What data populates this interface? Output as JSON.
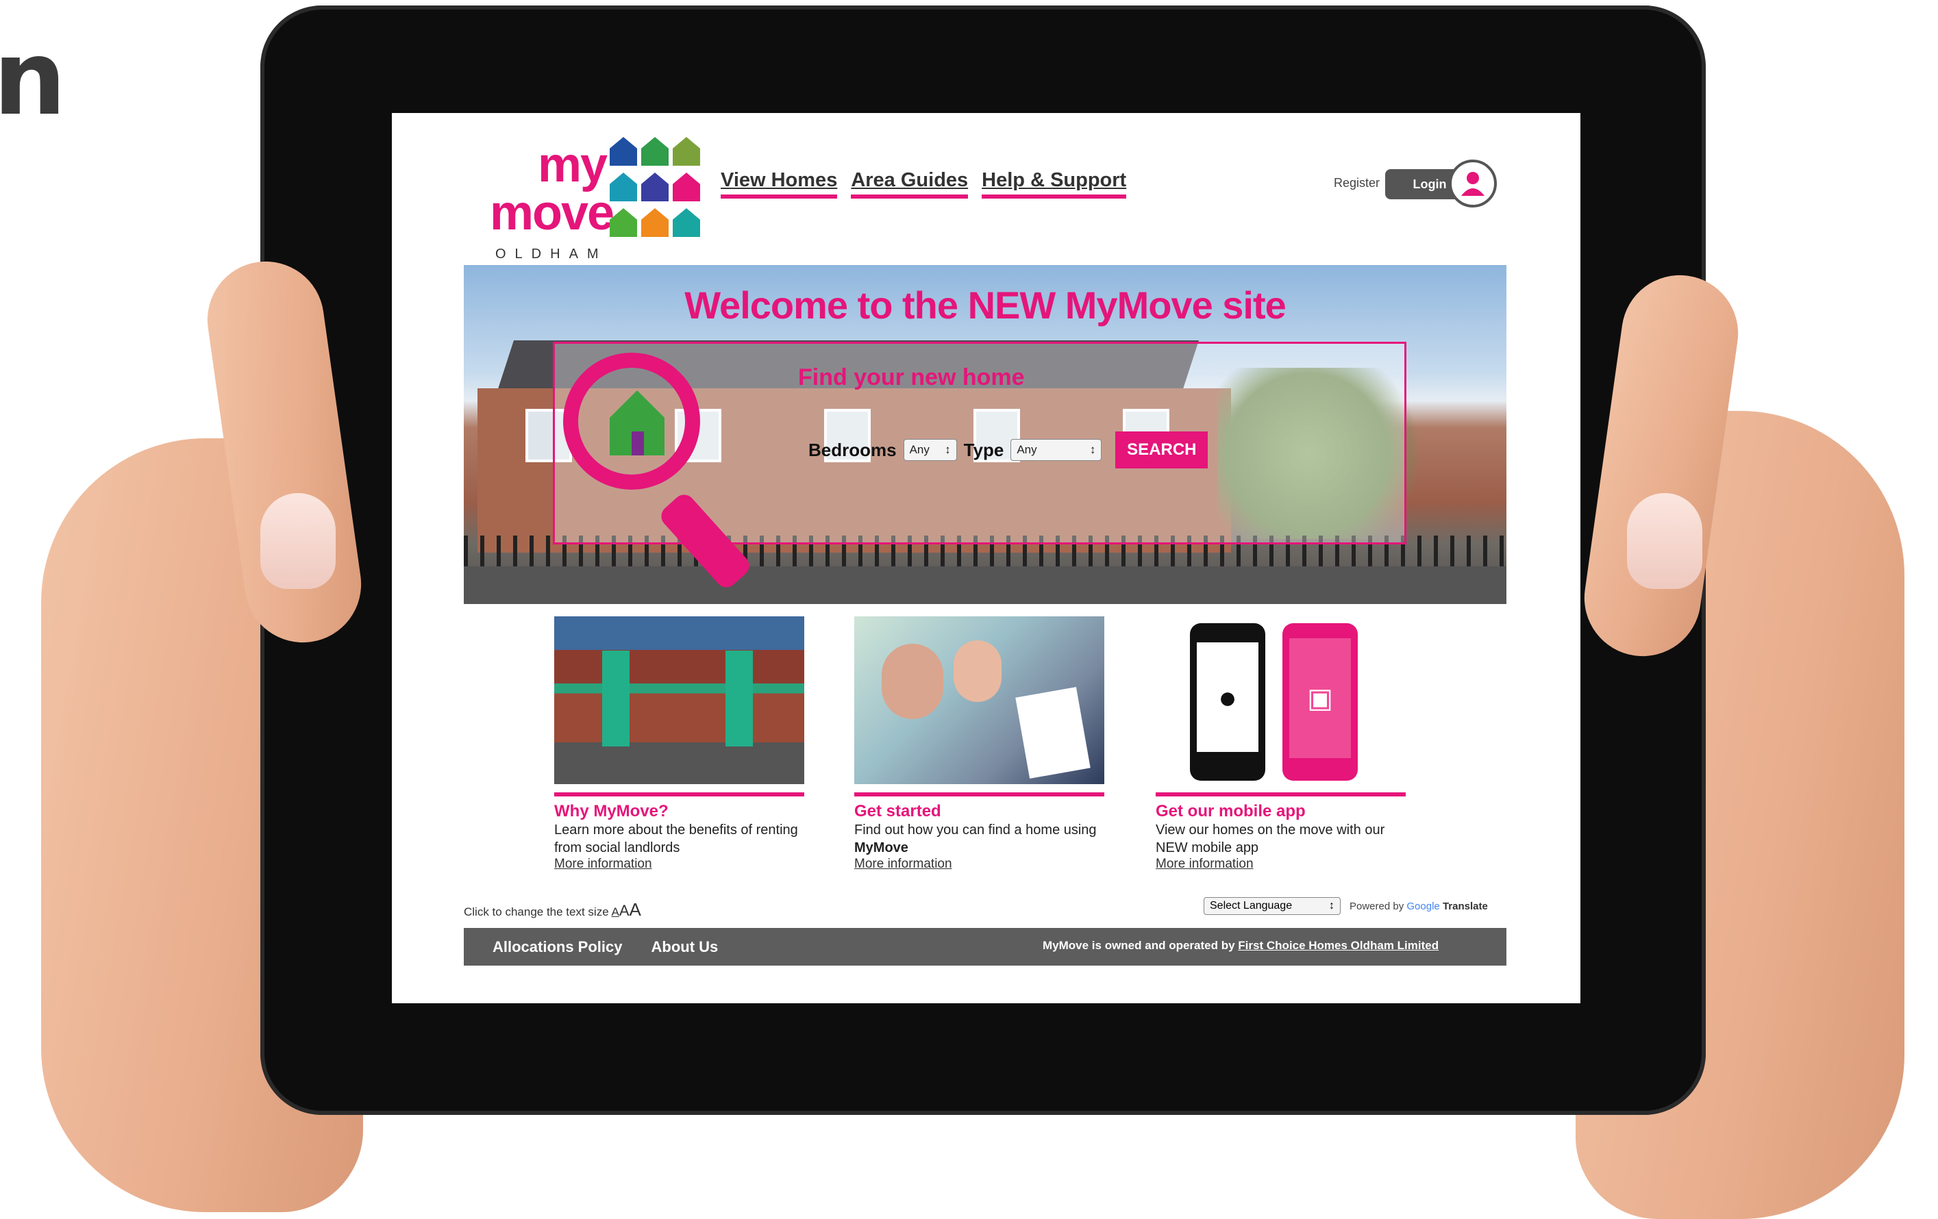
{
  "stray_glyph": "n",
  "site": {
    "logo": {
      "line1": "my",
      "line2": "move",
      "line3": "OLDHAM"
    },
    "nav": [
      "View Homes",
      "Area Guides",
      "Help & Support"
    ],
    "register_label": "Register",
    "login_label": "Login",
    "hero": {
      "title": "Welcome to the NEW MyMove site",
      "search_title": "Find your new home",
      "bedrooms_label": "Bedrooms",
      "bedrooms_value": "Any",
      "type_label": "Type",
      "type_value": "Any",
      "search_button": "SEARCH"
    },
    "cards": [
      {
        "title": "Why MyMove?",
        "text": "Learn more about the benefits of renting from social landlords",
        "link": "More information"
      },
      {
        "title": "Get started",
        "text_pre": "Find out how you can find a home using ",
        "text_bold": "MyMove",
        "link": "More information"
      },
      {
        "title": "Get our mobile app",
        "text": "View our homes on the move with our NEW mobile app",
        "link": "More information"
      }
    ],
    "textsize_label": "Click to change the text size",
    "textsize_options": [
      "A",
      "A",
      "A"
    ],
    "language_select": "Select Language",
    "powered_by": "Powered by",
    "google": "Google",
    "translate": "Translate",
    "footer": {
      "links": [
        "Allocations Policy",
        "About Us"
      ],
      "owned_text": "MyMove is owned and operated by ",
      "owned_company": "First Choice Homes Oldham Limited"
    }
  },
  "colors": {
    "brand_pink": "#e5157a",
    "footer_grey": "#5d5d5d"
  },
  "icons": [
    "magnifier-house-icon",
    "user-icon",
    "apple-icon",
    "android-icon",
    "house-icon"
  ]
}
